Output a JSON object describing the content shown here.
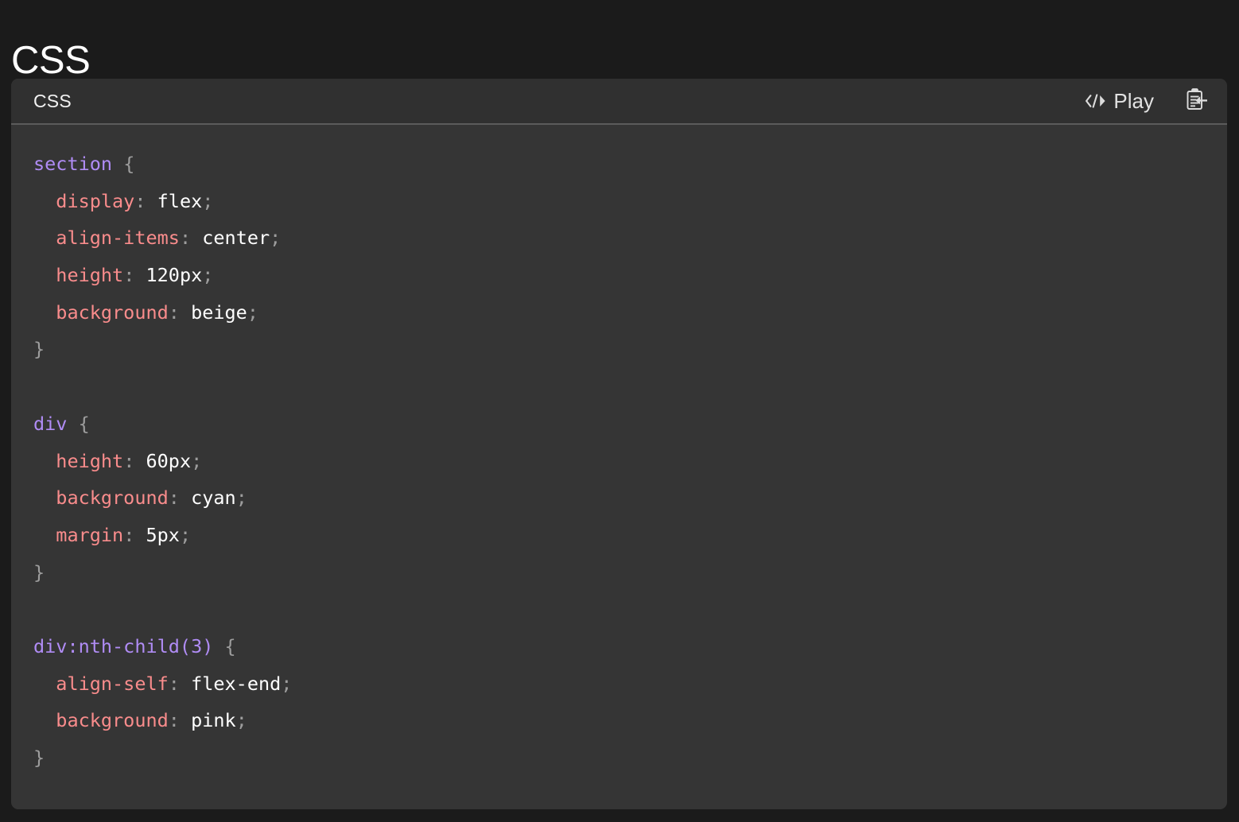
{
  "page": {
    "title": "CSS",
    "background_color": "#1b1b1b"
  },
  "card": {
    "title": "CSS",
    "background_color": "#353535",
    "header_background_color": "#303030",
    "divider_color": "#5b5b5b",
    "toolbar": {
      "play_label": "Play",
      "play_icon": "code-play-icon",
      "clipboard_icon": "paste-clipboard-icon"
    }
  },
  "syntax_colors": {
    "selector": "#b08cf5",
    "property": "#f98c8c",
    "value": "#ffffff",
    "punctuation": "#9d9d9d"
  },
  "code": {
    "language": "css",
    "lines": [
      {
        "indent": 0,
        "selector": "section",
        "punct_open": " {"
      },
      {
        "indent": 1,
        "prop": "display",
        "colon": ":",
        "value": "flex",
        "semi": ";"
      },
      {
        "indent": 1,
        "prop": "align-items",
        "colon": ":",
        "value": "center",
        "semi": ";"
      },
      {
        "indent": 1,
        "prop": "height",
        "colon": ":",
        "value": "120px",
        "semi": ";"
      },
      {
        "indent": 1,
        "prop": "background",
        "colon": ":",
        "value": "beige",
        "semi": ";"
      },
      {
        "indent": 0,
        "punct_close": "}"
      },
      {
        "blank": true
      },
      {
        "indent": 0,
        "selector": "div",
        "punct_open": " {"
      },
      {
        "indent": 1,
        "prop": "height",
        "colon": ":",
        "value": "60px",
        "semi": ";"
      },
      {
        "indent": 1,
        "prop": "background",
        "colon": ":",
        "value": "cyan",
        "semi": ";"
      },
      {
        "indent": 1,
        "prop": "margin",
        "colon": ":",
        "value": "5px",
        "semi": ";"
      },
      {
        "indent": 0,
        "punct_close": "}"
      },
      {
        "blank": true
      },
      {
        "indent": 0,
        "selector": "div:nth-child(3)",
        "punct_open": " {"
      },
      {
        "indent": 1,
        "prop": "align-self",
        "colon": ":",
        "value": "flex-end",
        "semi": ";"
      },
      {
        "indent": 1,
        "prop": "background",
        "colon": ":",
        "value": "pink",
        "semi": ";"
      },
      {
        "indent": 0,
        "punct_close": "}"
      }
    ],
    "plain_text": "section {\n  display: flex;\n  align-items: center;\n  height: 120px;\n  background: beige;\n}\n\ndiv {\n  height: 60px;\n  background: cyan;\n  margin: 5px;\n}\n\ndiv:nth-child(3) {\n  align-self: flex-end;\n  background: pink;\n}"
  }
}
